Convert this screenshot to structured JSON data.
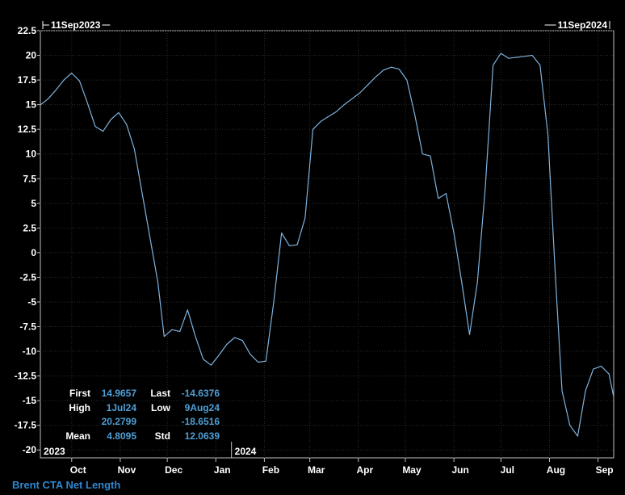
{
  "chart_data": {
    "type": "line",
    "title": "",
    "xlabel": "",
    "ylabel": "",
    "ylim": [
      -20.8,
      22.5
    ],
    "y_ticks": [
      22.5,
      20,
      17.5,
      15,
      12.5,
      10,
      7.5,
      5,
      2.5,
      0,
      -2.5,
      -5,
      -7.5,
      -10,
      -12.5,
      -15,
      -17.5,
      -20
    ],
    "y_tick_labels": [
      "22.5",
      "20",
      "17.5",
      "15",
      "12.5",
      "10",
      "7.5",
      "5",
      "2.5",
      "0",
      "-2.5",
      "-5",
      "-7.5",
      "-10",
      "-12.5",
      "-15",
      "-17.5",
      "-20"
    ],
    "x_ticks": [
      {
        "label": "Oct",
        "date": "2023-10-01"
      },
      {
        "label": "Nov",
        "date": "2023-11-01"
      },
      {
        "label": "Dec",
        "date": "2023-12-01"
      },
      {
        "label": "Jan",
        "date": "2024-01-01"
      },
      {
        "label": "Feb",
        "date": "2024-02-01"
      },
      {
        "label": "Mar",
        "date": "2024-03-01"
      },
      {
        "label": "Apr",
        "date": "2024-04-01"
      },
      {
        "label": "May",
        "date": "2024-05-01"
      },
      {
        "label": "Jun",
        "date": "2024-06-01"
      },
      {
        "label": "Jul",
        "date": "2024-07-01"
      },
      {
        "label": "Aug",
        "date": "2024-08-01"
      },
      {
        "label": "Sep",
        "date": "2024-09-01"
      }
    ],
    "year_labels": [
      {
        "label": "2023",
        "date": "2023-09-11"
      },
      {
        "label": "2024",
        "date": "2024-01-11"
      }
    ],
    "range": {
      "start": "11Sep2023",
      "end": "11Sep2024"
    },
    "xlim": [
      "2023-09-11",
      "2024-09-11"
    ],
    "line_color": "#7fb2dc",
    "background": "#000000",
    "grid": true,
    "grid_color": "#2c2c2c",
    "series": [
      {
        "name": "Brent CTA Net Length",
        "x": [
          "2023-09-11",
          "2023-09-16",
          "2023-09-21",
          "2023-09-26",
          "2023-10-01",
          "2023-10-06",
          "2023-10-11",
          "2023-10-16",
          "2023-10-21",
          "2023-10-26",
          "2023-10-31",
          "2023-11-05",
          "2023-11-10",
          "2023-11-15",
          "2023-11-20",
          "2023-11-25",
          "2023-11-29",
          "2023-12-04",
          "2023-12-09",
          "2023-12-14",
          "2023-12-19",
          "2023-12-24",
          "2023-12-29",
          "2024-01-03",
          "2024-01-08",
          "2024-01-13",
          "2024-01-18",
          "2024-01-23",
          "2024-01-28",
          "2024-02-02",
          "2024-02-07",
          "2024-02-12",
          "2024-02-17",
          "2024-02-22",
          "2024-02-27",
          "2024-03-03",
          "2024-03-08",
          "2024-03-13",
          "2024-03-18",
          "2024-03-23",
          "2024-03-28",
          "2024-04-02",
          "2024-04-07",
          "2024-04-12",
          "2024-04-17",
          "2024-04-22",
          "2024-04-27",
          "2024-05-02",
          "2024-05-07",
          "2024-05-12",
          "2024-05-17",
          "2024-05-22",
          "2024-05-27",
          "2024-06-01",
          "2024-06-06",
          "2024-06-11",
          "2024-06-16",
          "2024-06-21",
          "2024-06-26",
          "2024-07-01",
          "2024-07-06",
          "2024-07-11",
          "2024-07-16",
          "2024-07-21",
          "2024-07-26",
          "2024-07-31",
          "2024-08-05",
          "2024-08-09",
          "2024-08-14",
          "2024-08-19",
          "2024-08-24",
          "2024-08-29",
          "2024-09-03",
          "2024-09-08",
          "2024-09-11"
        ],
        "values": [
          14.97,
          15.6,
          16.5,
          17.5,
          18.2,
          17.4,
          15.2,
          12.8,
          12.3,
          13.5,
          14.2,
          13.0,
          10.5,
          6.0,
          1.5,
          -3.0,
          -8.5,
          -7.8,
          -8.0,
          -5.8,
          -8.5,
          -10.8,
          -11.4,
          -10.4,
          -9.3,
          -8.6,
          -8.9,
          -10.3,
          -11.1,
          -11.0,
          -5.0,
          2.0,
          0.7,
          0.8,
          3.5,
          12.5,
          13.3,
          13.8,
          14.3,
          15.0,
          15.6,
          16.2,
          17.0,
          17.8,
          18.5,
          18.8,
          18.6,
          17.5,
          14.0,
          10.0,
          9.8,
          5.5,
          6.0,
          2.0,
          -3.0,
          -8.3,
          -3.0,
          6.5,
          19.0,
          20.2,
          19.7,
          19.8,
          19.9,
          20.0,
          19.0,
          12.0,
          -3.0,
          -14.0,
          -17.5,
          -18.6,
          -14.0,
          -11.8,
          -11.5,
          -12.3,
          -14.64
        ]
      }
    ],
    "stats": {
      "first_label": "First",
      "first_value": "14.9657",
      "last_label": "Last",
      "last_value": "-14.6376",
      "high_label": "High",
      "high_date": "1Jul24",
      "high_value": "20.2799",
      "low_label": "Low",
      "low_date": "9Aug24",
      "low_value": "-18.6516",
      "mean_label": "Mean",
      "mean_value": "4.8095",
      "std_label": "Std",
      "std_value": "12.0639"
    },
    "footer_label": "Brent CTA Net Length"
  }
}
